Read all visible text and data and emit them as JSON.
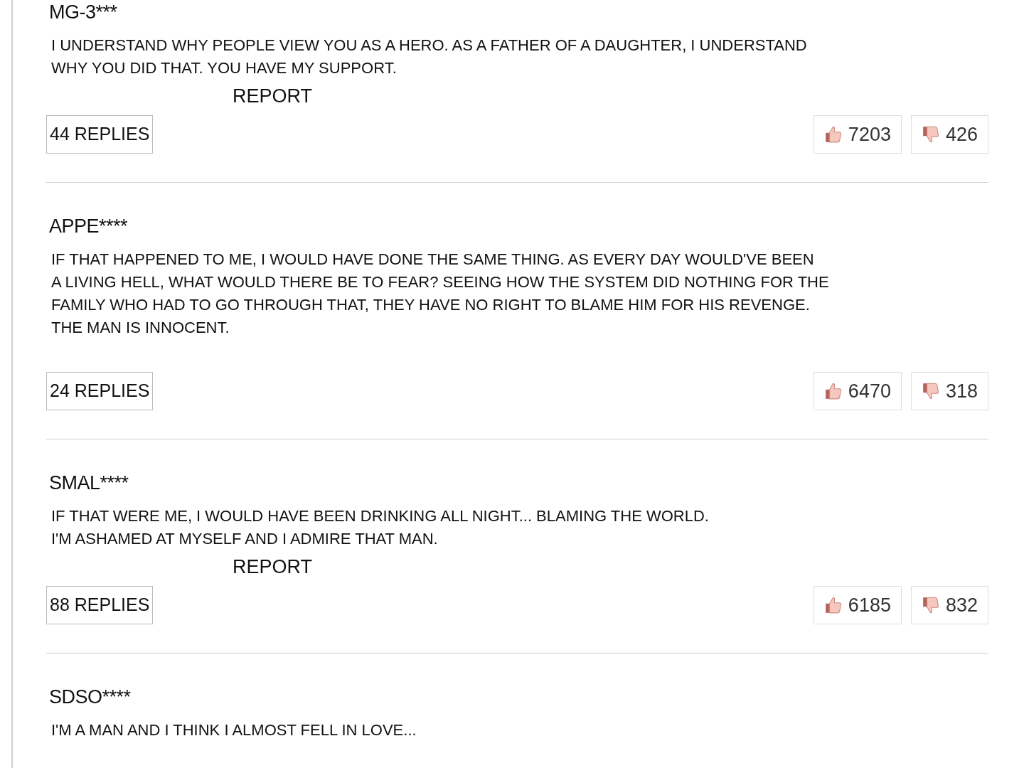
{
  "comments": [
    {
      "user": "MG-3***",
      "lines": [
        "I UNDERSTAND WHY PEOPLE VIEW YOU AS A HERO. AS A FATHER OF A DAUGHTER, I UNDERSTAND",
        "WHY YOU DID THAT. YOU HAVE MY SUPPORT."
      ],
      "report": "REPORT",
      "replies": "44 REPLIES",
      "likes": "7203",
      "dislikes": "426"
    },
    {
      "user": "APPE****",
      "lines": [
        "IF THAT HAPPENED TO ME, I WOULD HAVE DONE THE SAME THING. AS EVERY DAY WOULD'VE BEEN",
        "A LIVING HELL, WHAT WOULD THERE BE TO FEAR? SEEING HOW THE SYSTEM DID NOTHING FOR THE",
        "FAMILY WHO HAD TO GO THROUGH THAT, THEY HAVE NO RIGHT TO BLAME HIM FOR HIS REVENGE.",
        "THE MAN IS INNOCENT."
      ],
      "replies": "24 REPLIES",
      "likes": "6470",
      "dislikes": "318"
    },
    {
      "user": "SMAL****",
      "lines": [
        "IF THAT WERE ME, I WOULD HAVE BEEN DRINKING ALL NIGHT... BLAMING THE WORLD.",
        "I'M ASHAMED AT MYSELF AND I ADMIRE THAT MAN."
      ],
      "report": "REPORT",
      "replies": "88 REPLIES",
      "likes": "6185",
      "dislikes": "832"
    },
    {
      "user": "SDSO****",
      "lines": [
        "I'M A MAN AND I THINK I ALMOST FELL IN LOVE..."
      ]
    }
  ]
}
